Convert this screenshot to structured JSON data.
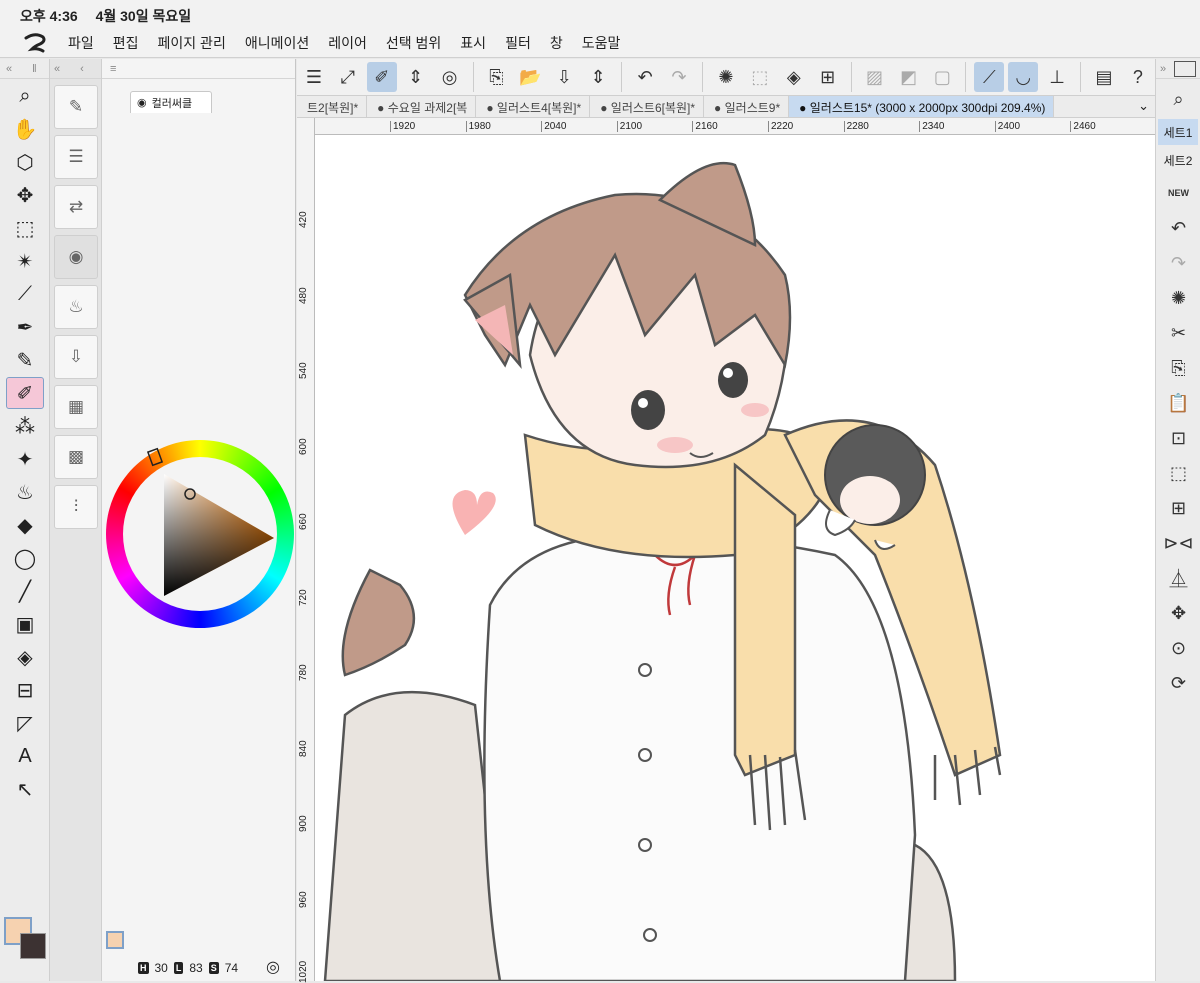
{
  "status": {
    "time": "오후 4:36",
    "date": "4월 30일 목요일"
  },
  "menu": [
    "파일",
    "편집",
    "페이지 관리",
    "애니메이션",
    "레이어",
    "선택 범위",
    "표시",
    "필터",
    "창",
    "도움말"
  ],
  "color_panel": {
    "tab_label": "컬러써클",
    "h_label": "H",
    "h": "30",
    "l_label": "L",
    "l": "83",
    "s_label": "S",
    "s": "74",
    "fg_color": "#f6d2b0",
    "bg_color": "#3c3232"
  },
  "doc_tabs": [
    "트2[복원]*",
    "수요일 과제2[복",
    "일러스트4[복원]*",
    "일러스트6[복원]*",
    "일러스트9*",
    "일러스트15* (3000 x 2000px 300dpi 209.4%)"
  ],
  "ruler_h": [
    "1920",
    "1980",
    "2040",
    "2100",
    "2160",
    "2220",
    "2280",
    "2340",
    "2400",
    "2460"
  ],
  "ruler_v": [
    "420",
    "480",
    "540",
    "600",
    "660",
    "720",
    "780",
    "840",
    "900",
    "960",
    "1020"
  ],
  "right_panel": {
    "set1": "세트1",
    "set2": "세트2",
    "new_badge": "NEW"
  },
  "colors": {
    "accent_selected": "#b8cee6",
    "tab_active": "#c7daf0",
    "tool_selected": "#f5c7d7"
  }
}
